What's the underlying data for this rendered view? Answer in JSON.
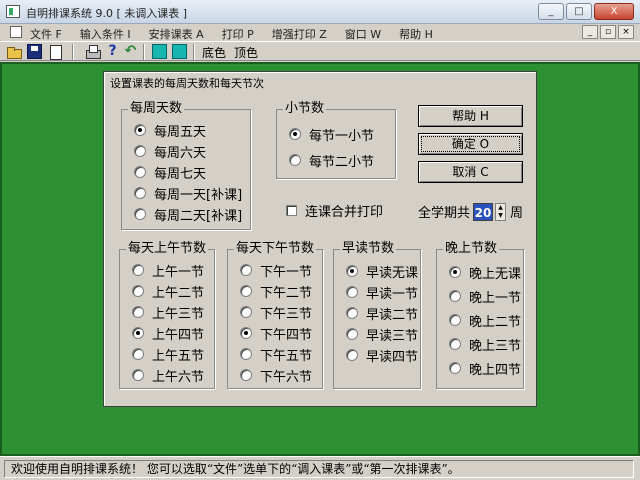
{
  "window": {
    "title": "自明排课系统 9.0 [ 未调入课表 ]",
    "controls": [
      "_",
      "□",
      "X"
    ]
  },
  "menu": {
    "items": [
      "文件 F",
      "输入条件 I",
      "安排课表 A",
      "打印 P",
      "增强打印 Z",
      "窗口 W",
      "帮助 H"
    ],
    "mdi_controls": [
      "_",
      "▫",
      "×"
    ]
  },
  "toolbar": {
    "bottom_color_label": "底色",
    "top_color_label": "顶色",
    "icons": [
      "folder-open-icon",
      "save-disk-icon",
      "new-page-icon",
      "printer-icon",
      "help-question-icon",
      "undo-arrow-icon",
      "cyan-square-icon",
      "cyan-square-icon"
    ],
    "accent_color": "#17b6b0"
  },
  "workspace": {
    "background": "#2d9133"
  },
  "dialog": {
    "title": "设置课表的每周天数和每天节次",
    "days_per_week": {
      "label": "每周天数",
      "options": [
        "每周五天",
        "每周六天",
        "每周七天",
        "每周一天[补课]",
        "每周二天[补课]"
      ],
      "selected": 0
    },
    "lesson_unit": {
      "label": "小节数",
      "options": [
        "每节一小节",
        "每节二小节"
      ],
      "selected": 0
    },
    "merge_print": {
      "label": "连课合并打印",
      "checked": false
    },
    "weeks": {
      "prefix": "全学期共",
      "value": "20",
      "suffix": "周"
    },
    "buttons": {
      "help": "帮助 H",
      "ok": "确定 O",
      "cancel": "取消 C"
    },
    "morning": {
      "label": "每天上午节数",
      "options": [
        "上午一节",
        "上午二节",
        "上午三节",
        "上午四节",
        "上午五节",
        "上午六节"
      ],
      "selected": 3
    },
    "afternoon": {
      "label": "每天下午节数",
      "options": [
        "下午一节",
        "下午二节",
        "下午三节",
        "下午四节",
        "下午五节",
        "下午六节"
      ],
      "selected": 3
    },
    "early_reading": {
      "label": "早读节数",
      "options": [
        "早读无课",
        "早读一节",
        "早读二节",
        "早读三节",
        "早读四节"
      ],
      "selected": 0
    },
    "evening": {
      "label": "晚上节数",
      "options": [
        "晚上无课",
        "晚上一节",
        "晚上二节",
        "晚上三节",
        "晚上四节"
      ],
      "selected": 0
    }
  },
  "status": {
    "message": "欢迎使用自明排课系统！ 您可以选取“文件”选单下的“调入课表”或“第一次排课表”。"
  }
}
